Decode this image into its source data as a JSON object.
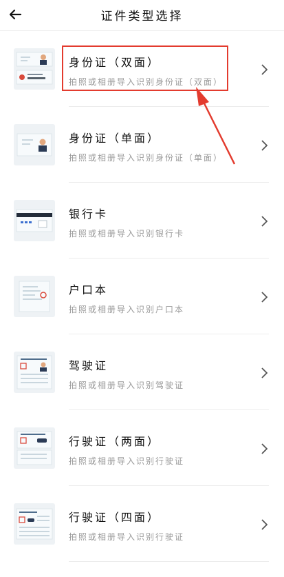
{
  "header": {
    "title": "证件类型选择",
    "back_icon": "arrow-left-icon"
  },
  "items": [
    {
      "title": "身份证（双面）",
      "subtitle": "拍照或相册导入识别身份证（双面）",
      "icon": "id-card-double-icon"
    },
    {
      "title": "身份证（单面）",
      "subtitle": "拍照或相册导入识别身份证（单面）",
      "icon": "id-card-single-icon"
    },
    {
      "title": "银行卡",
      "subtitle": "拍照或相册导入识别银行卡",
      "icon": "bank-card-icon"
    },
    {
      "title": "户口本",
      "subtitle": "拍照或相册导入识别户口本",
      "icon": "household-register-icon"
    },
    {
      "title": "驾驶证",
      "subtitle": "拍照或相册导入识别驾驶证",
      "icon": "driver-license-icon"
    },
    {
      "title": "行驶证（两面）",
      "subtitle": "拍照或相册导入识别行驶证",
      "icon": "vehicle-license-two-icon"
    },
    {
      "title": "行驶证（四面）",
      "subtitle": "拍照或相册导入识别行驶证",
      "icon": "vehicle-license-four-icon"
    }
  ],
  "colors": {
    "highlight": "#e33b2e",
    "subtitle": "#9a9a9a",
    "divider": "#ececec"
  }
}
